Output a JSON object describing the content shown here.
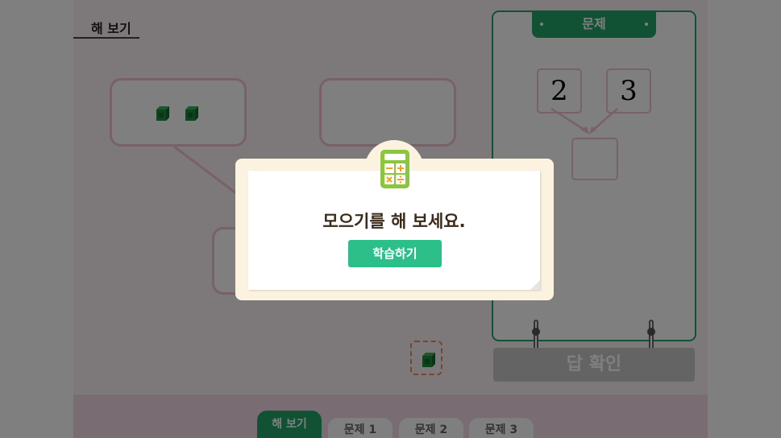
{
  "practice": {
    "section_title": "해 보기"
  },
  "problem": {
    "tab_label": "문제",
    "number_left": "2",
    "number_right": "3",
    "answer_value": ""
  },
  "answer_button": {
    "label": "답 확인"
  },
  "bottom_tabs": [
    {
      "label": "해 보기",
      "active": true
    },
    {
      "label": "문제 1",
      "active": false
    },
    {
      "label": "문제 2",
      "active": false
    },
    {
      "label": "문제 3",
      "active": false
    }
  ],
  "modal": {
    "icon": "calculator-icon",
    "message": "모으기를 해 보세요.",
    "button_label": "학습하기"
  },
  "colors": {
    "accent_green": "#22a56a",
    "button_green": "#2cbf89",
    "box_border_pink": "#f1c3cf",
    "cube_green": "#1f8a3a",
    "tray_border": "#ea8a5a"
  }
}
